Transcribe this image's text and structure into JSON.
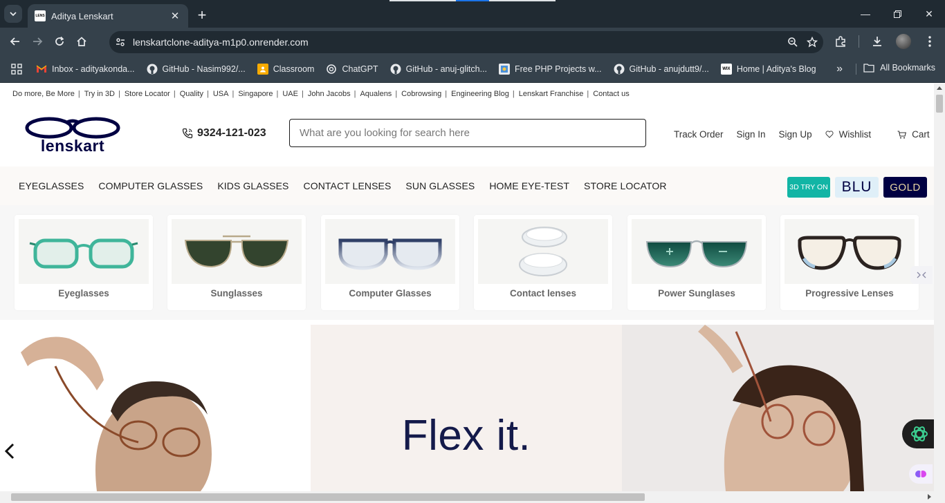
{
  "browser": {
    "tab_title": "Aditya Lenskart",
    "tab_favicon_text": "LENS",
    "url": "lenskartclone-aditya-m1p0.onrender.com",
    "bookmarks": [
      {
        "label": "Inbox - adityakonda...",
        "icon": "gmail-icon"
      },
      {
        "label": "GitHub - Nasim992/...",
        "icon": "github-icon"
      },
      {
        "label": "Classroom",
        "icon": "classroom-icon"
      },
      {
        "label": "ChatGPT",
        "icon": "chatgpt-icon"
      },
      {
        "label": "GitHub - anuj-glitch...",
        "icon": "github-icon"
      },
      {
        "label": "Free PHP Projects w...",
        "icon": "php-icon"
      },
      {
        "label": "GitHub - anujdutt9/...",
        "icon": "github-icon"
      },
      {
        "label": "Home | Aditya's Blog",
        "icon": "wix-icon"
      }
    ],
    "bookmarks_more": "»",
    "all_bookmarks": "All Bookmarks",
    "wix_text": "WIX"
  },
  "top_links": [
    "Do more, Be More",
    "Try in 3D",
    "Store Locator",
    "Quality",
    "USA",
    "Singapore",
    "UAE",
    "John Jacobs",
    "Aqualens",
    "Cobrowsing",
    "Engineering Blog",
    "Lenskart Franchise",
    "Contact us"
  ],
  "top_links_sep": "|",
  "header": {
    "logo_text": "lenskart",
    "phone": "9324-121-023",
    "search_placeholder": "What are you looking for search here",
    "links": {
      "track_order": "Track Order",
      "sign_in": "Sign In",
      "sign_up": "Sign Up",
      "wishlist": "Wishlist",
      "cart": "Cart"
    }
  },
  "nav": {
    "items": [
      "EYEGLASSES",
      "COMPUTER GLASSES",
      "KIDS GLASSES",
      "CONTACT LENSES",
      "SUN GLASSES",
      "HOME EYE-TEST",
      "STORE LOCATOR"
    ],
    "badge_3d": "3D TRY ON",
    "badge_blu": "BLU",
    "badge_gold": "GOLD"
  },
  "categories": [
    {
      "label": "Eyeglasses"
    },
    {
      "label": "Sunglasses"
    },
    {
      "label": "Computer Glasses"
    },
    {
      "label": "Contact lenses"
    },
    {
      "label": "Power Sunglases"
    },
    {
      "label": "Progressive Lenses"
    }
  ],
  "banner": {
    "headline": "Flex it.",
    "prev_label": "‹"
  },
  "colors": {
    "brand_navy": "#000042",
    "teal": "#12b5a5",
    "chrome_dark": "#202a32",
    "chrome_mid": "#35414b"
  }
}
